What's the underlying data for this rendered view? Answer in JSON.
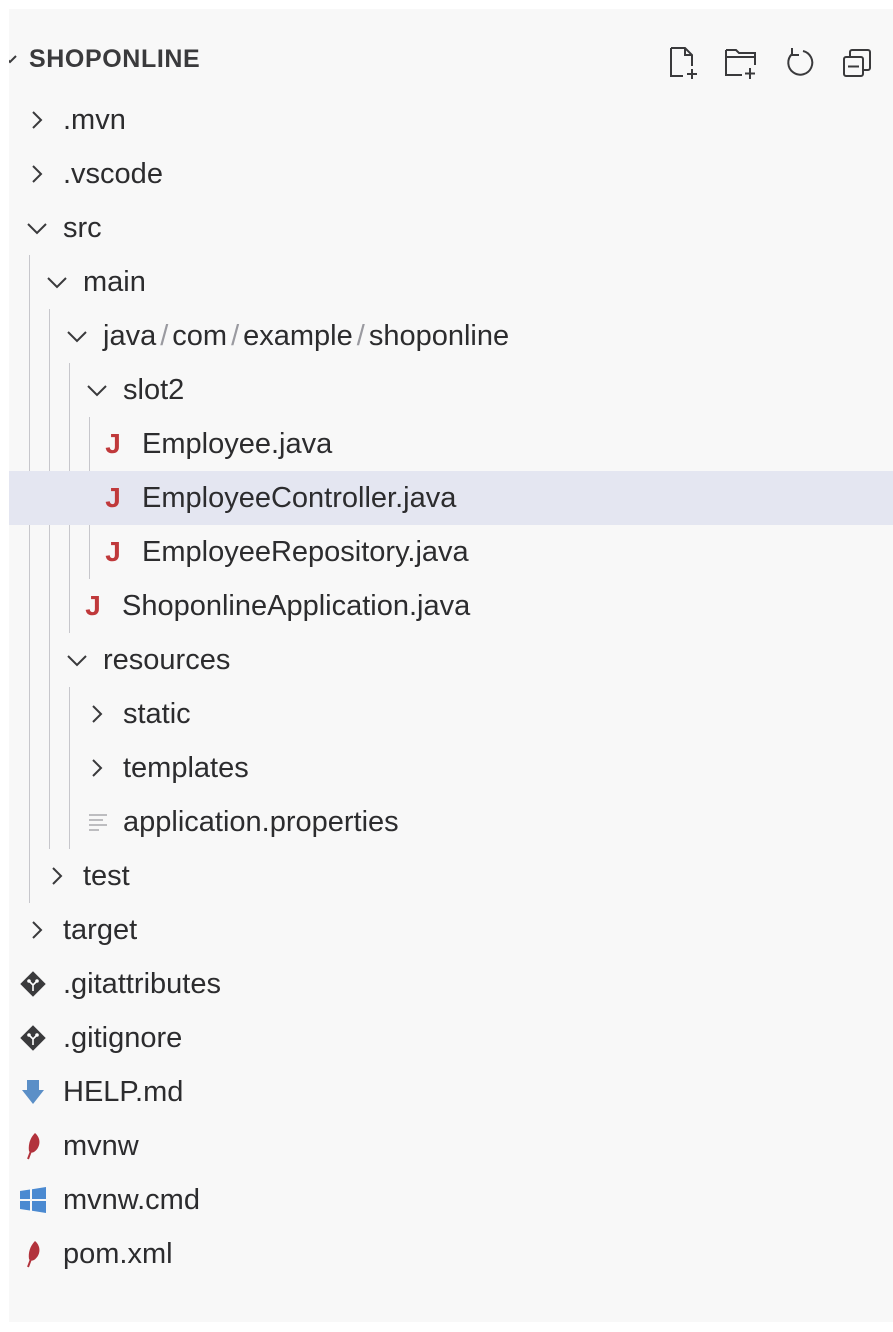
{
  "explorer": {
    "title": "SHOPONLINE",
    "actions": [
      {
        "name": "new-file-icon"
      },
      {
        "name": "new-folder-icon"
      },
      {
        "name": "refresh-icon"
      },
      {
        "name": "collapse-all-icon"
      }
    ]
  },
  "tree": {
    "mvn": ".mvn",
    "vscode": ".vscode",
    "src": "src",
    "main": "main",
    "java_path": [
      "java",
      "com",
      "example",
      "shoponline"
    ],
    "path_separator": "/",
    "slot2": "slot2",
    "employee": "Employee.java",
    "employee_controller": "EmployeeController.java",
    "employee_repository": "EmployeeRepository.java",
    "shoponline_application": "ShoponlineApplication.java",
    "resources": "resources",
    "static": "static",
    "templates": "templates",
    "application_properties": "application.properties",
    "test": "test",
    "target": "target",
    "gitattributes": ".gitattributes",
    "gitignore": ".gitignore",
    "help_md": "HELP.md",
    "mvnw": "mvnw",
    "mvnw_cmd": "mvnw.cmd",
    "pom_xml": "pom.xml"
  },
  "selected_item": "EmployeeController.java",
  "colors": {
    "java": "#c0393b",
    "maven": "#b2323c",
    "markdown": "#5b8fc7",
    "windows": "#4b8ad1",
    "git": "#3a3a3c",
    "selection": "#e4e6f1"
  }
}
